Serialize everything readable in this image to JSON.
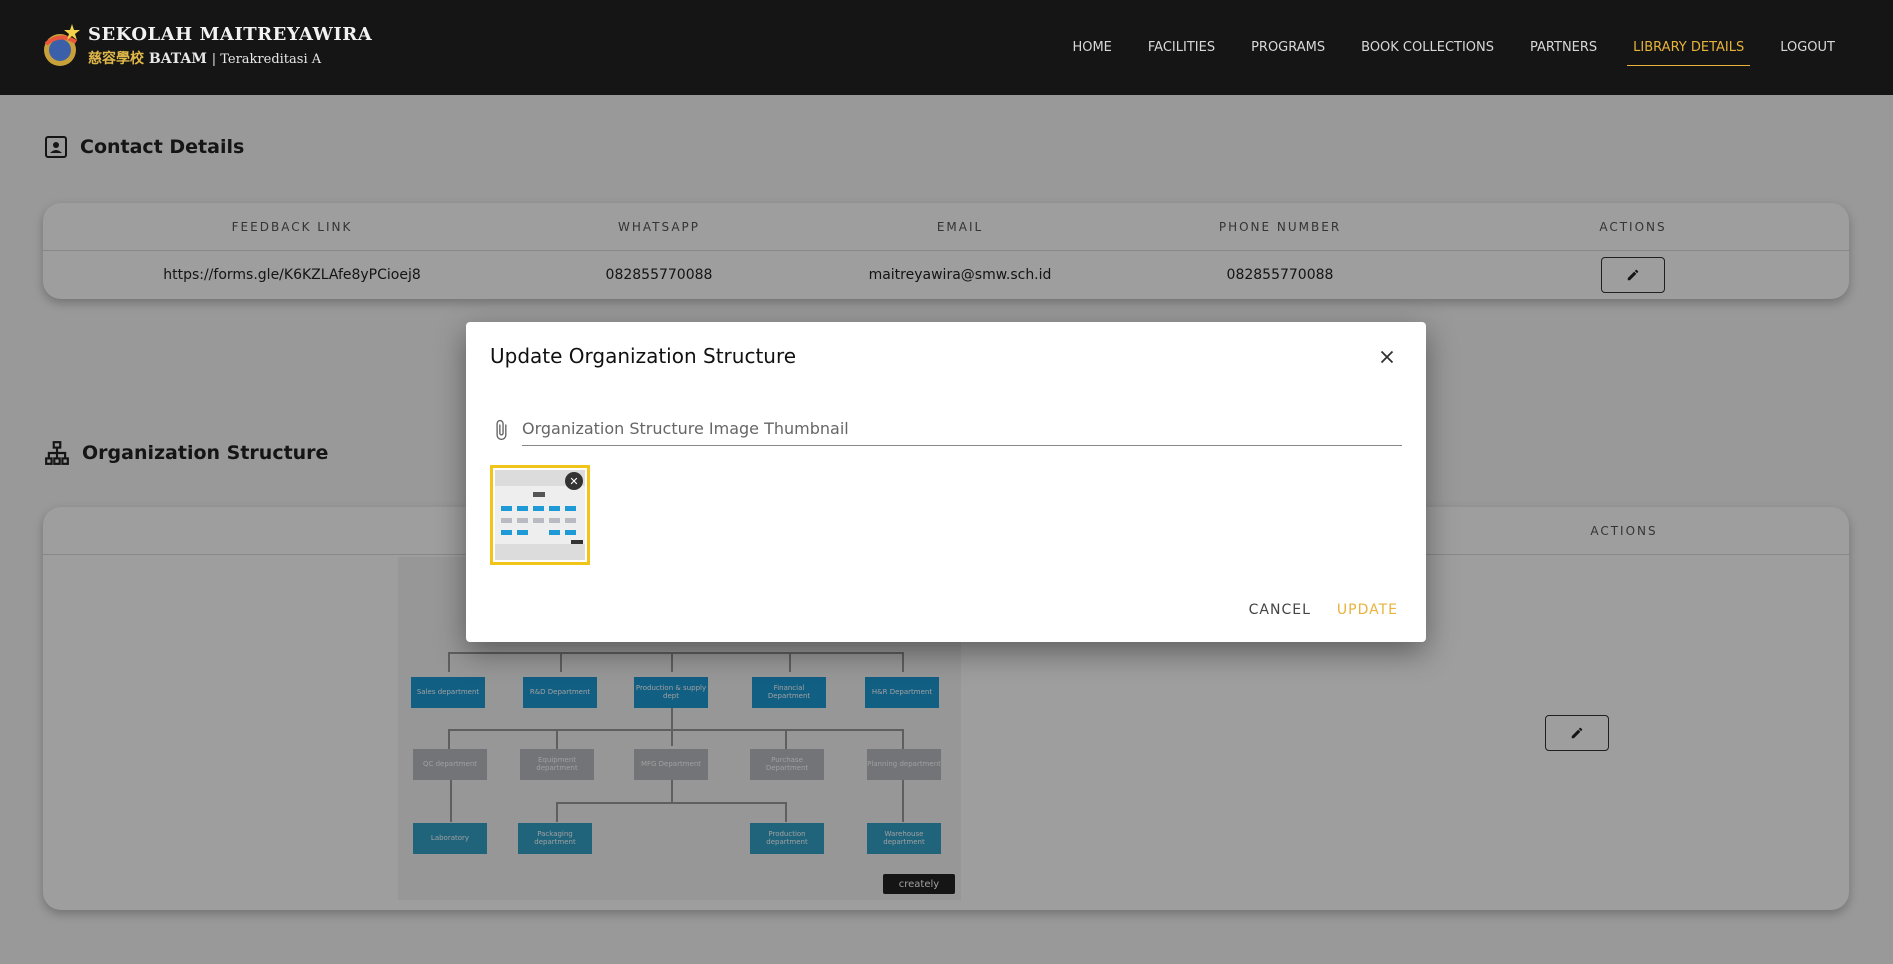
{
  "brand": {
    "line1": "SEKOLAH MAITREYAWIRA",
    "chinese": "慈容學校",
    "line2_city": "BATAM",
    "line2_accr": "| Terakreditasi A"
  },
  "nav": [
    {
      "label": "HOME"
    },
    {
      "label": "FACILITIES"
    },
    {
      "label": "PROGRAMS"
    },
    {
      "label": "BOOK COLLECTIONS"
    },
    {
      "label": "PARTNERS"
    },
    {
      "label": "LIBRARY DETAILS",
      "active": true
    },
    {
      "label": "LOGOUT"
    }
  ],
  "contact": {
    "title": "Contact Details",
    "headers": [
      "FEEDBACK LINK",
      "WHATSAPP",
      "EMAIL",
      "PHONE NUMBER",
      "ACTIONS"
    ],
    "row": {
      "feedback": "https://forms.gle/K6KZLAfe8yPCioej8",
      "whatsapp": "082855770088",
      "email": "maitreyawira@smw.sch.id",
      "phone": "082855770088"
    }
  },
  "org": {
    "title": "Organization Structure",
    "actions_header": "ACTIONS",
    "chart_boxes": {
      "row1": [
        "Sales department",
        "R&D Department",
        "Production & supply dept",
        "Financial Department",
        "H&R Department"
      ],
      "row2": [
        "QC department",
        "Equipment department",
        "MFG Department",
        "Purchase Department",
        "Planning department"
      ],
      "row3": [
        "Laboratory",
        "Packaging department",
        "Production department",
        "Warehouse department"
      ]
    },
    "watermark": "creately"
  },
  "dialog": {
    "title": "Update Organization Structure",
    "file_placeholder": "Organization Structure Image Thumbnail",
    "cancel": "CANCEL",
    "update": "UPDATE"
  },
  "colors": {
    "accent": "#e7b33b",
    "header_bg": "#151515",
    "thumb_border": "#f0c419"
  }
}
